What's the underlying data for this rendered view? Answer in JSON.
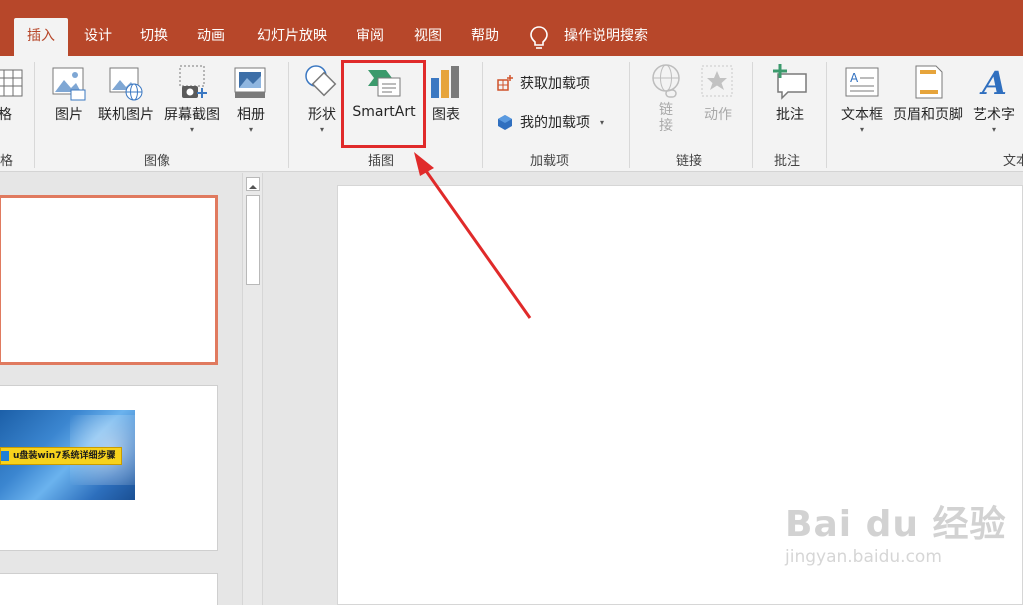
{
  "tabs": [
    {
      "label": "插入",
      "active": true
    },
    {
      "label": "设计"
    },
    {
      "label": "切换"
    },
    {
      "label": "动画"
    },
    {
      "label": "幻灯片放映"
    },
    {
      "label": "审阅"
    },
    {
      "label": "视图"
    },
    {
      "label": "帮助"
    }
  ],
  "tell_me": "操作说明搜索",
  "ribbon": {
    "partial_left_label": "格",
    "partial_left_group": "格",
    "images": {
      "group": "图像",
      "picture": "图片",
      "online_picture": "联机图片",
      "screenshot": "屏幕截图",
      "album": "相册"
    },
    "illustrations": {
      "group": "插图",
      "shapes": "形状",
      "smartart": "SmartArt",
      "chart": "图表"
    },
    "addins": {
      "group": "加载项",
      "get": "获取加载项",
      "mine": "我的加载项"
    },
    "links": {
      "group": "链接",
      "link_top": "链",
      "link_bottom": "接",
      "action": "动作"
    },
    "comments": {
      "group": "批注",
      "comment": "批注"
    },
    "text": {
      "group": "文本",
      "textbox": "文本框",
      "header_footer": "页眉和页脚",
      "wordart": "艺术字"
    }
  },
  "thumbnail_banner": "u盘装win7系统详细步骤",
  "watermark": {
    "main": "Bai du 经验",
    "sub": "jingyan.baidu.com"
  },
  "colors": {
    "accent": "#b7472a",
    "highlight": "#e02a2a",
    "selected_thumb": "#e07a5f"
  }
}
